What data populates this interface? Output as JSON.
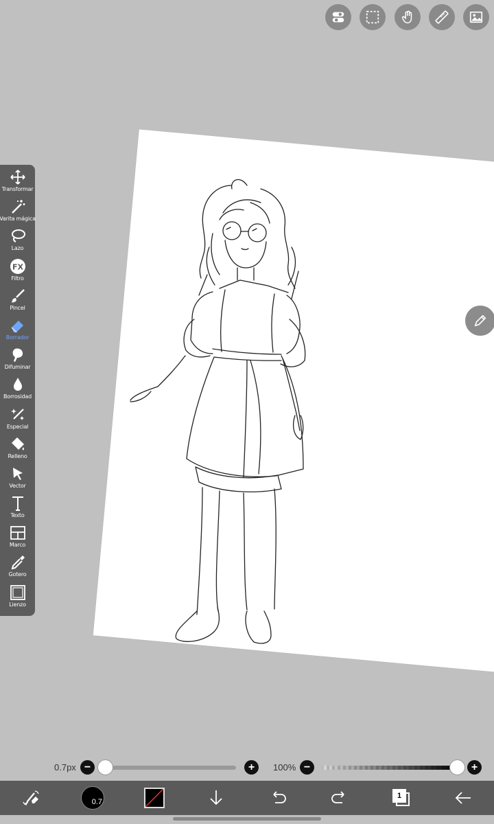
{
  "top_buttons": [
    {
      "name": "toggle-icon"
    },
    {
      "name": "selection-icon"
    },
    {
      "name": "hand-icon"
    },
    {
      "name": "ruler-icon"
    },
    {
      "name": "image-icon"
    }
  ],
  "tools": [
    {
      "label": "Transformar",
      "icon": "move-arrows-icon"
    },
    {
      "label": "Varita mágica",
      "icon": "magic-wand-icon"
    },
    {
      "label": "Lazo",
      "icon": "lasso-icon"
    },
    {
      "label": "Filtro",
      "icon": "fx-icon"
    },
    {
      "label": "Pincel",
      "icon": "brush-icon"
    },
    {
      "label": "Borrador",
      "icon": "eraser-icon",
      "active": true
    },
    {
      "label": "Difuminar",
      "icon": "smudge-icon"
    },
    {
      "label": "Borrosidad",
      "icon": "blur-drop-icon"
    },
    {
      "label": "Especial",
      "icon": "sparkle-brush-icon"
    },
    {
      "label": "Relleno",
      "icon": "fill-bucket-icon"
    },
    {
      "label": "Vector",
      "icon": "vector-arrow-icon"
    },
    {
      "label": "Texto",
      "icon": "text-icon"
    },
    {
      "label": "Marco",
      "icon": "frame-icon"
    },
    {
      "label": "Gotero",
      "icon": "eyedropper-icon"
    },
    {
      "label": "Lienzo",
      "icon": "canvas-icon"
    }
  ],
  "sliders": {
    "size_label": "0.7px",
    "size_value_fraction": 0.0,
    "opacity_label": "100%",
    "opacity_value_fraction": 1.0,
    "minus": "−",
    "plus": "+"
  },
  "bottom_bar": {
    "brush_size_badge": "0.7",
    "layer_number": "1",
    "active_color": "#000000"
  },
  "colors": {
    "background": "#c0c0c0",
    "toolbar": "#5c5c5c",
    "active_tool": "#6ea6ff"
  }
}
